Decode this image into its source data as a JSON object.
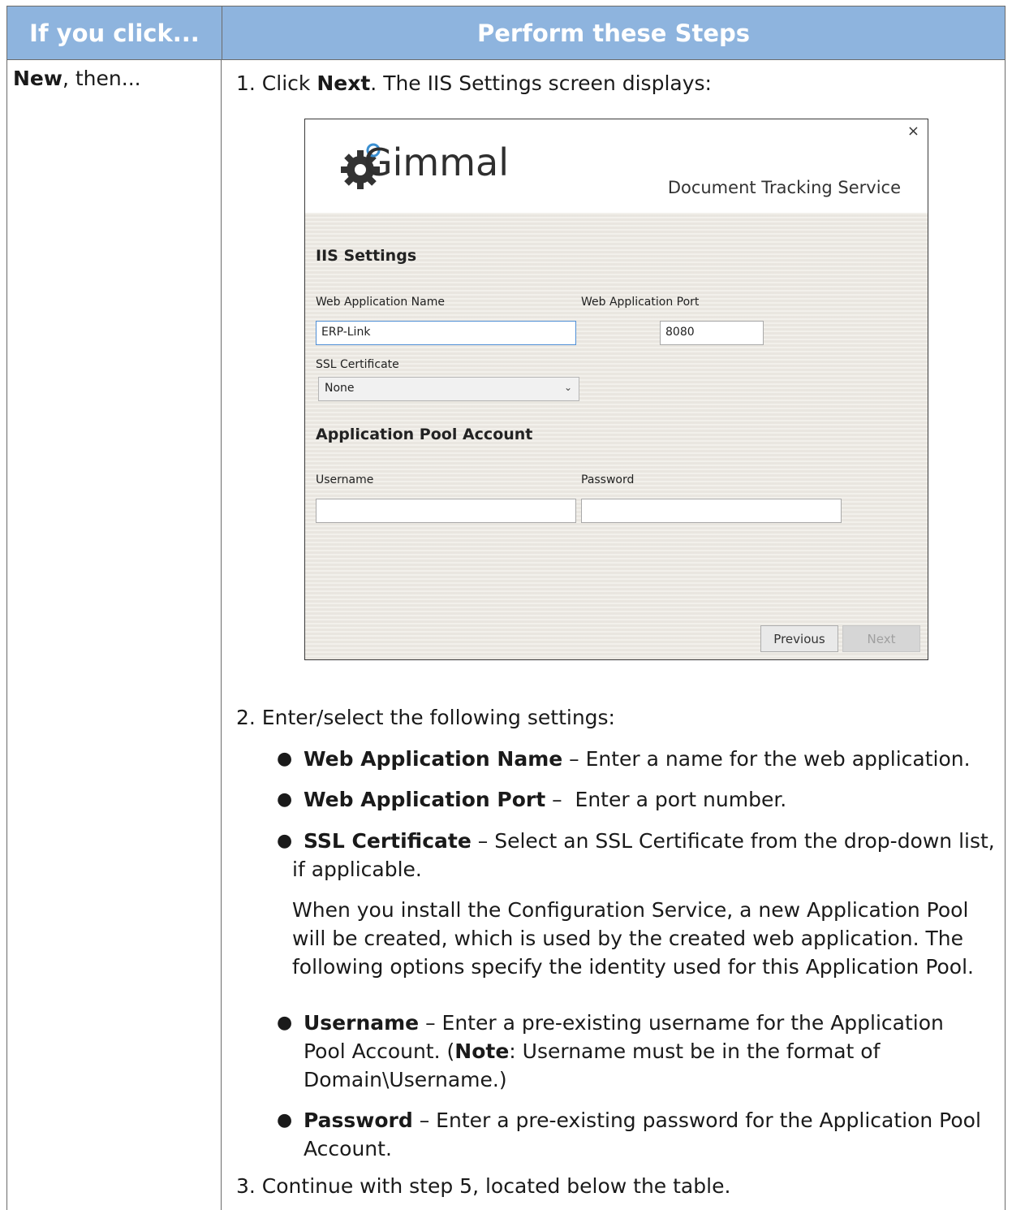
{
  "header": {
    "col1": "If you click...",
    "col2": "Perform these Steps"
  },
  "row": {
    "col1_bold": "New",
    "col1_rest": ", then..."
  },
  "step1": {
    "prefix": "1. Click ",
    "bold": "Next",
    "suffix": ". The IIS Settings screen displays:"
  },
  "dialog": {
    "close": "×",
    "logo_text": "Gimmal",
    "service": "Document Tracking Service",
    "iis_heading": "IIS Settings",
    "web_app_name_label": "Web Application Name",
    "web_app_name_value": "ERP-Link",
    "web_app_port_label": "Web Application Port",
    "web_app_port_value": "8080",
    "ssl_label": "SSL Certificate",
    "ssl_value": "None",
    "pool_heading": "Application Pool Account",
    "username_label": "Username",
    "username_value": "",
    "password_label": "Password",
    "password_value": "",
    "prev_button": "Previous",
    "next_button": "Next"
  },
  "step2": {
    "intro": "2. Enter/select the following settings:",
    "b1_bold": "Web Application Name",
    "b1_rest": " – Enter a name for the web application.",
    "b2_bold": "Web Application Port",
    "b2_rest": " –  Enter a port number.",
    "b3_bold": "SSL Certificate",
    "b3_rest": " – Select an SSL Certificate from the drop-down list,",
    "b3_line2": "if applicable.",
    "para_l1": "When you install the Configuration Service, a new Application Pool",
    "para_l2": "will be created, which is used by the created web application. The",
    "para_l3": "following options specify the identity used for this Application Pool.",
    "b4_bold": "Username",
    "b4_rest": " – Enter a pre-existing username for the Application",
    "b4_l2a": "Pool Account. (",
    "b4_l2bold": "Note",
    "b4_l2b": ": Username must be in the format of",
    "b4_l3": "Domain\\Username.)",
    "b5_bold": "Password",
    "b5_rest": " – Enter a pre-existing password for the Application Pool",
    "b5_l2": "Account."
  },
  "step3": {
    "text": "3. Continue with step 5, located below the table."
  }
}
